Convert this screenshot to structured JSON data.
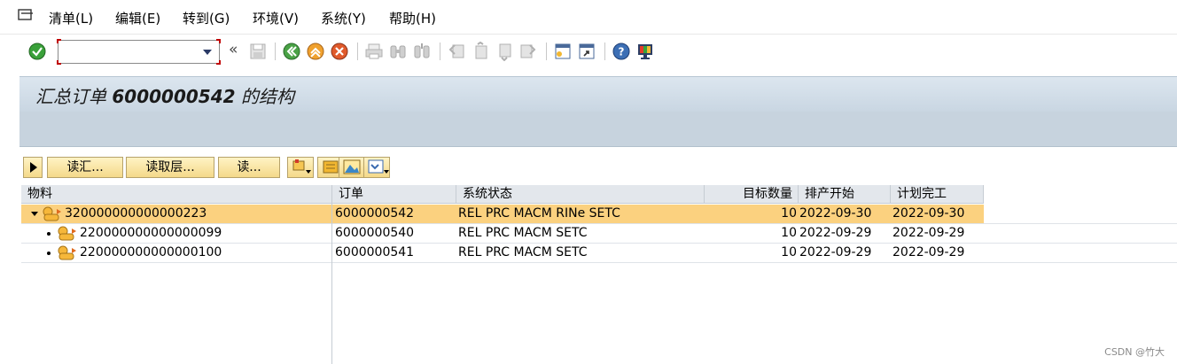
{
  "menu": {
    "items": [
      "清单(L)",
      "编辑(E)",
      "转到(G)",
      "环境(V)",
      "系统(Y)",
      "帮助(H)"
    ]
  },
  "toolbar": {
    "command_value": "",
    "back_symbol": "«"
  },
  "title": {
    "prefix": "汇总订单",
    "order_no": "6000000542",
    "suffix": "的结构"
  },
  "app_toolbar": {
    "buttons": [
      "读汇...",
      "读取层...",
      "读..."
    ]
  },
  "grid": {
    "headers": [
      "物料",
      "订单",
      "系统状态",
      "目标数量",
      "排产开始",
      "计划完工"
    ],
    "rows": [
      {
        "material": "320000000000000223",
        "order": "6000000542",
        "status": "REL  PRC  MACM RINe SETC",
        "qty": "10",
        "start": "2022-09-30",
        "finish": "2022-09-30"
      },
      {
        "material": "220000000000000099",
        "order": "6000000540",
        "status": "REL  PRC  MACM SETC",
        "qty": "10",
        "start": "2022-09-29",
        "finish": "2022-09-29"
      },
      {
        "material": "220000000000000100",
        "order": "6000000541",
        "status": "REL  PRC  MACM SETC",
        "qty": "10",
        "start": "2022-09-29",
        "finish": "2022-09-29"
      }
    ]
  },
  "watermark": "CSDN @竹大",
  "colors": {
    "selected_row": "#fbd17f",
    "title_bar": "#dce6ef",
    "button_fill": "#f4d98a",
    "confirm_green": "#3aa13a",
    "cancel_red": "#e05a2b"
  }
}
